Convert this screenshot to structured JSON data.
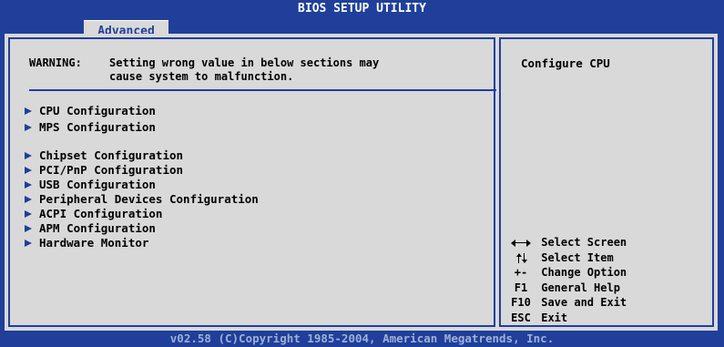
{
  "title": "BIOS SETUP UTILITY",
  "active_tab": "Advanced",
  "warning": {
    "label": "WARNING:",
    "line1": "Setting wrong value in below sections may",
    "line2": "cause system to malfunction."
  },
  "menu_items": [
    "CPU Configuration",
    "MPS Configuration",
    "Chipset Configuration",
    "PCI/PnP Configuration",
    "USB Configuration",
    "Peripheral Devices Configuration",
    "ACPI Configuration",
    "APM Configuration",
    "Hardware Monitor"
  ],
  "help": {
    "title": "Configure CPU"
  },
  "legend": [
    {
      "key": "",
      "icon": "left-right-arrow-icon",
      "action": "Select Screen"
    },
    {
      "key": "",
      "icon": "up-down-arrow-icon",
      "action": "Select Item"
    },
    {
      "key": "+-",
      "icon": "",
      "action": "Change Option"
    },
    {
      "key": "F1",
      "icon": "",
      "action": "General Help"
    },
    {
      "key": "F10",
      "icon": "",
      "action": "Save and Exit"
    },
    {
      "key": "ESC",
      "icon": "",
      "action": "Exit"
    }
  ],
  "footer": "v02.58 (C)Copyright 1985-2004, American Megatrends, Inc.",
  "colors": {
    "background": "#1f3f9a",
    "panel": "#d9d9d9",
    "text": "#000000",
    "header_text": "#ffffff"
  }
}
